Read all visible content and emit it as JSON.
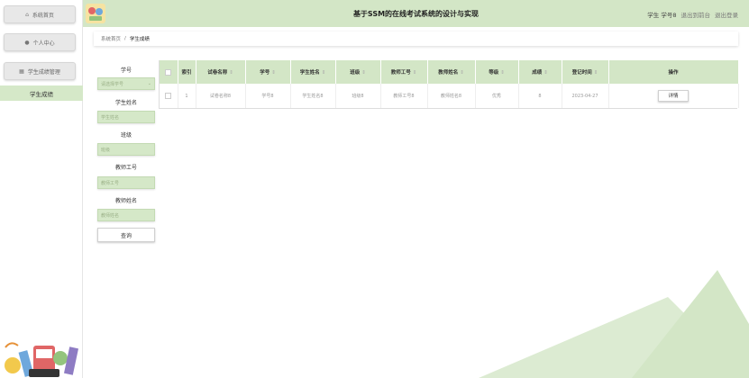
{
  "sidebar": {
    "items": [
      {
        "label": "系统首页",
        "icon": "home-icon"
      },
      {
        "label": "个人中心",
        "icon": "user-icon"
      },
      {
        "label": "学生成绩管理",
        "icon": "grid-icon"
      }
    ],
    "sub_item": "学生成绩"
  },
  "header": {
    "title": "基于SSM的在线考试系统的设计与实现",
    "user": "学生 学号8",
    "links": [
      "退出到前台",
      "退出登录"
    ]
  },
  "breadcrumb": {
    "home": "系统首页",
    "separator": "/",
    "current": "学生成绩"
  },
  "search": {
    "fields": [
      {
        "label": "学号",
        "placeholder": "请选择学号"
      },
      {
        "label": "学生姓名",
        "placeholder": "学生姓名"
      },
      {
        "label": "班级",
        "placeholder": "班级"
      },
      {
        "label": "教师工号",
        "placeholder": "教师工号"
      },
      {
        "label": "教师姓名",
        "placeholder": "教师姓名"
      }
    ],
    "query_label": "查询"
  },
  "table": {
    "headers": [
      "索引",
      "试卷名称",
      "学号",
      "学生姓名",
      "班级",
      "教师工号",
      "教师姓名",
      "等级",
      "成绩",
      "登记时间",
      "操作"
    ],
    "rows": [
      {
        "index": "1",
        "paper": "试卷名称8",
        "student_no": "学号8",
        "student_name": "学生姓名8",
        "class": "班级8",
        "teacher_no": "教师工号8",
        "teacher_name": "教师姓名8",
        "grade": "优秀",
        "score": "8",
        "time": "2023-04-27",
        "action": "详情"
      }
    ]
  },
  "colors": {
    "accent": "#d3e6c6",
    "accent_dark": "#c3dab3"
  }
}
